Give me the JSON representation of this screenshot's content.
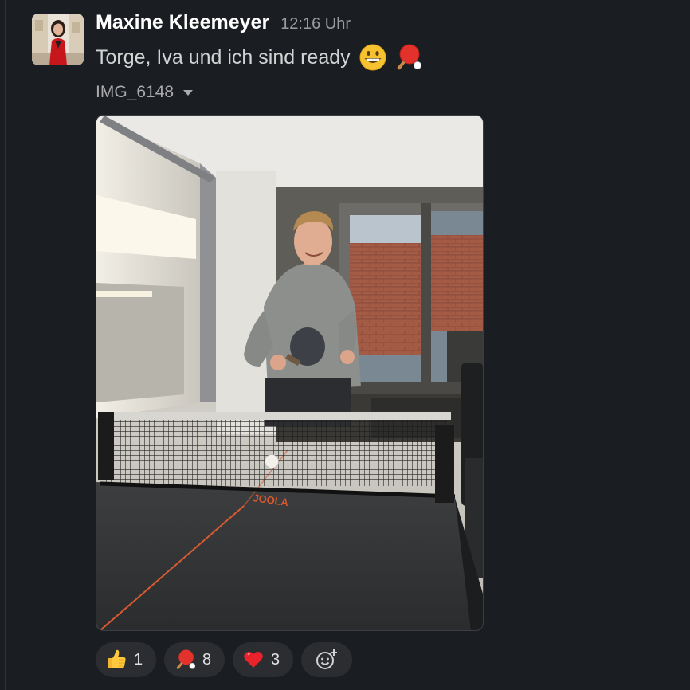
{
  "message": {
    "sender": "Maxine Kleemeyer",
    "time": "12:16 Uhr",
    "text": "Torge, Iva und ich sind ready",
    "text_emojis": [
      "grinning-face-icon",
      "ping-pong-icon"
    ]
  },
  "attachment": {
    "file_name": "IMG_6148",
    "image_brand_text": "JOOLA"
  },
  "reactions": [
    {
      "emoji": "thumbs-up-icon",
      "count": "1"
    },
    {
      "emoji": "ping-pong-icon",
      "count": "8"
    },
    {
      "emoji": "red-heart-icon",
      "count": "3"
    }
  ],
  "colors": {
    "background": "#1a1d21",
    "reaction_pill": "#2b2d31",
    "sender": "#ffffff",
    "text": "#d1d2d3",
    "muted": "#9b9c9e"
  }
}
